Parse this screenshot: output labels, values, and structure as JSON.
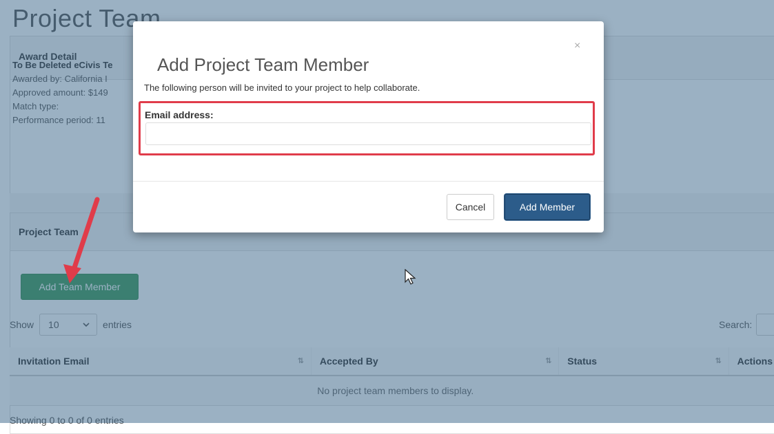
{
  "page": {
    "title": "Project Team"
  },
  "award_panel": {
    "heading": "Award Detail",
    "name": "To Be Deleted eCivis Te",
    "awarded_by": "Awarded by: California I",
    "approved_amount": "Approved amount: $149",
    "match_type": "Match type:",
    "performance_period": "Performance period: 11"
  },
  "team_panel": {
    "heading": "Project Team",
    "add_button": "Add Team Member",
    "show_label": "Show",
    "entries_value": "10",
    "entries_label": "entries",
    "search_label": "Search:",
    "table": {
      "columns": [
        "Invitation Email",
        "Accepted By",
        "Status",
        "Actions"
      ],
      "empty_message": "No project team members to display."
    },
    "info": "Showing 0 to 0 of 0 entries"
  },
  "modal": {
    "close": "×",
    "title": "Add Project Team Member",
    "description": "The following person will be invited to your project to help collaborate.",
    "email_label": "Email address:",
    "email_value": "",
    "email_placeholder": "",
    "cancel": "Cancel",
    "submit": "Add Member"
  },
  "colors": {
    "highlight": "#e03c4a",
    "arrow": "#e03c4a",
    "add_team_button": "#3e9b5a",
    "add_member_button": "#2c5c8a",
    "backdrop": "#5f8eb0"
  },
  "icons": {
    "sort_icon": "sort-arrows",
    "chevron": "chevron-down",
    "cursor": "mouse-pointer"
  }
}
